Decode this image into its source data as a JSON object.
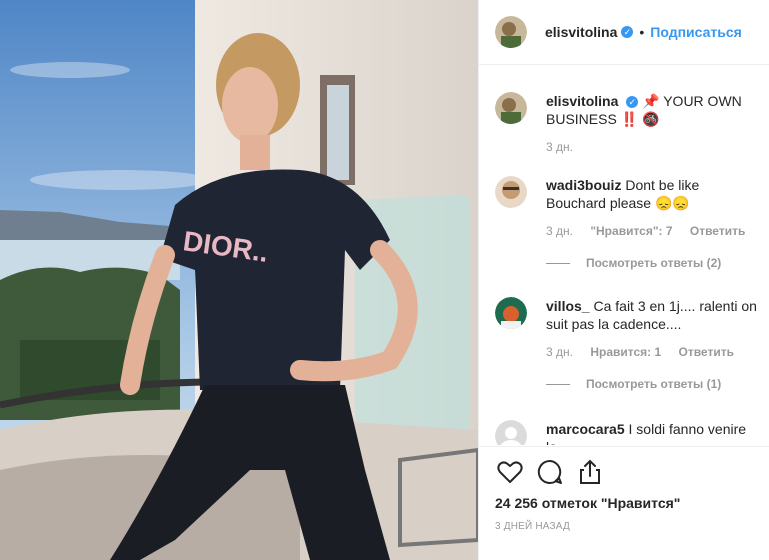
{
  "post": {
    "username": "elisvitolina",
    "verified_mark": "✓",
    "follow_label": "Подписаться",
    "separator": "•"
  },
  "caption": {
    "username": "elisvitolina",
    "pin_emoji": "📌",
    "text": "YOUR OWN BUSINESS ‼️",
    "no_symbol": "🚳",
    "time": "3 дн."
  },
  "comments": [
    {
      "username": "wadi3bouiz",
      "text": "Dont be like Bouchard please 😞😞",
      "time": "3 дн.",
      "likes": "\"Нравится\": 7",
      "reply": "Ответить",
      "view_replies": "Посмотреть ответы (2)"
    },
    {
      "username": "villos_",
      "text": "Ca fait 3 en 1j.... ralenti on suit pas la cadence....",
      "time": "3 дн.",
      "likes": "Нравится: 1",
      "reply": "Ответить",
      "view_replies": "Посмотреть ответы (1)"
    },
    {
      "username": "marcocara5",
      "text": "I soldi fanno venire la"
    }
  ],
  "footer": {
    "likes_count": "24 256 отметок \"Нравится\"",
    "date": "3 ДНЕЙ НАЗАД",
    "icons": [
      "heart-icon",
      "comment-icon",
      "share-icon"
    ]
  },
  "colors": {
    "accent": "#3897f0",
    "muted": "#999999",
    "text": "#262626"
  }
}
